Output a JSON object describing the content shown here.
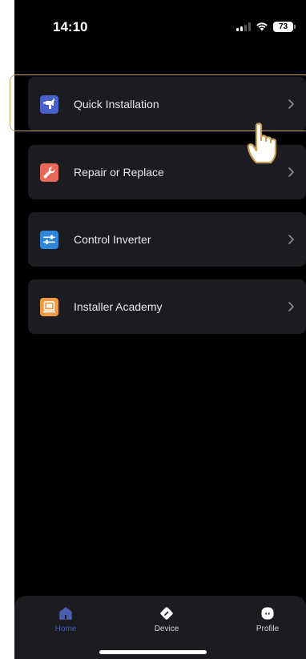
{
  "status_bar": {
    "time": "14:10",
    "battery": "73"
  },
  "menu": {
    "items": [
      {
        "label": "Quick Installation",
        "icon": "drill-icon",
        "icon_color": "#4b5fc9"
      },
      {
        "label": "Repair or Replace",
        "icon": "wrench-icon",
        "icon_color": "#e8685a"
      },
      {
        "label": "Control Inverter",
        "icon": "sliders-icon",
        "icon_color": "#2f86d8"
      },
      {
        "label": "Installer Academy",
        "icon": "academy-icon",
        "icon_color": "#ef9a45"
      }
    ],
    "highlighted_index": 0
  },
  "tab_bar": {
    "tabs": [
      {
        "label": "Home",
        "icon": "home-icon",
        "active": true
      },
      {
        "label": "Device",
        "icon": "device-icon",
        "active": false
      },
      {
        "label": "Profile",
        "icon": "profile-icon",
        "active": false
      }
    ]
  },
  "colors": {
    "background": "#000000",
    "card": "#1c1b1f",
    "accent": "#4b5dad",
    "highlight_outline": "#c9a25a"
  }
}
